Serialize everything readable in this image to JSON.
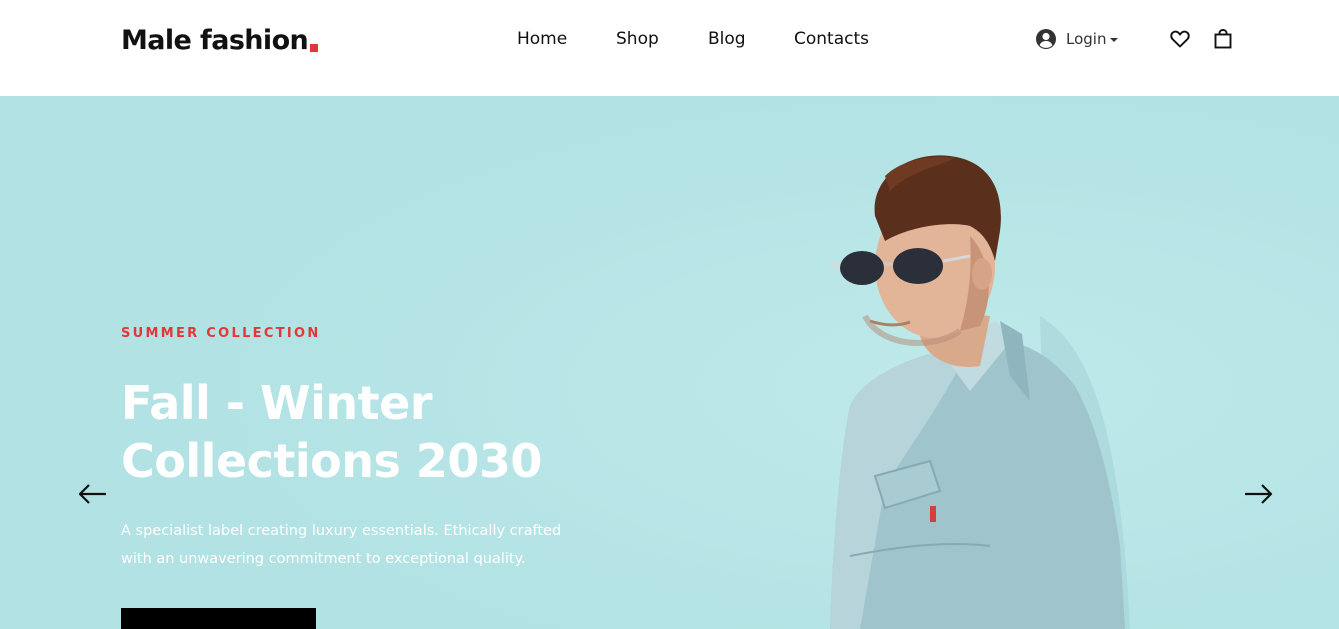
{
  "header": {
    "logo_text": "Male fashion",
    "logo_accent_color": "#e53637",
    "nav": {
      "home": "Home",
      "shop": "Shop",
      "blog": "Blog",
      "contacts": "Contacts"
    },
    "login_label": "Login",
    "icons": [
      "user-circle-icon",
      "heart-icon",
      "shopping-bag-icon"
    ]
  },
  "hero": {
    "background_color": "#b4e3e5",
    "subtitle": "SUMMER COLLECTION",
    "subtitle_color": "#e53637",
    "headline": "Fall - Winter Collections 2030",
    "description": "A specialist label creating luxury essentials. Ethically crafted with an unwavering commitment to exceptional quality.",
    "cta_color": "#000000",
    "prev_icon": "arrow-left-icon",
    "next_icon": "arrow-right-icon"
  }
}
